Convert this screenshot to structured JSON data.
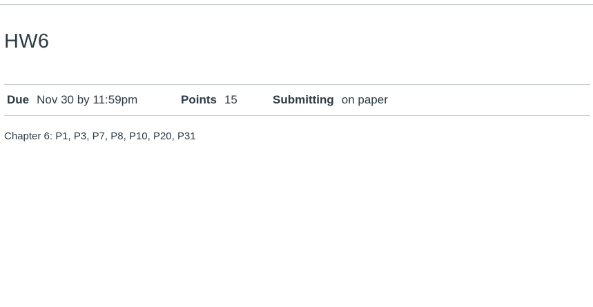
{
  "assignment": {
    "title": "HW6",
    "details": {
      "due_label": "Due",
      "due_value": "Nov 30 by 11:59pm",
      "points_label": "Points",
      "points_value": "15",
      "submitting_label": "Submitting",
      "submitting_value": "on paper"
    },
    "description": "Chapter 6: P1, P3, P7, P8, P10, P20, P31"
  }
}
